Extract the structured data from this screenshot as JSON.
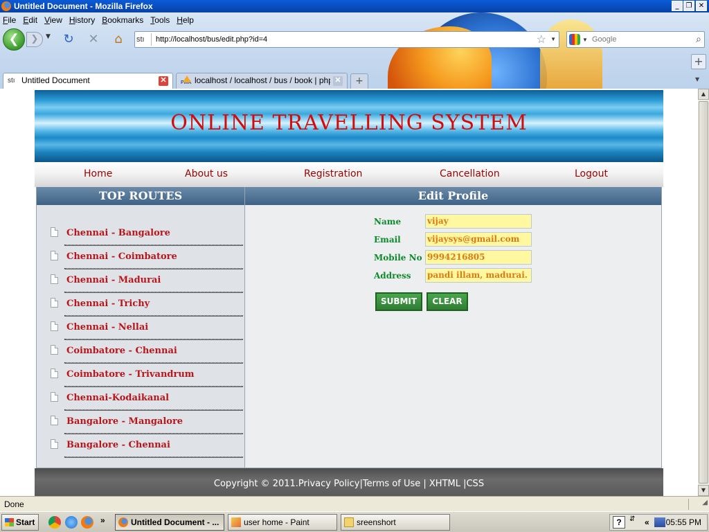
{
  "window": {
    "title": "Untitled Document - Mozilla Firefox",
    "controls": [
      "_",
      "❐",
      "✕"
    ]
  },
  "menu": [
    "File",
    "Edit",
    "View",
    "History",
    "Bookmarks",
    "Tools",
    "Help"
  ],
  "navbar": {
    "site_identity": "stı",
    "url": "http://localhost/bus/edit.php?id=4",
    "search_placeholder": "Google"
  },
  "tabs": [
    {
      "label": "Untitled Document",
      "favicon": "stı",
      "active": true
    },
    {
      "label": "localhost / localhost / bus / book | php...",
      "favicon": "PMA",
      "active": false
    }
  ],
  "site": {
    "title": "ONLINE TRAVELLING SYSTEM",
    "nav": [
      "Home",
      "About us",
      "Registration",
      "Cancellation",
      "Logout"
    ],
    "sidebar_heading": "TOP ROUTES",
    "routes": [
      "Chennai - Bangalore",
      "Chennai - Coimbatore",
      "Chennai - Madurai",
      "Chennai - Trichy",
      "Chennai - Nellai",
      "Coimbatore - Chennai",
      "Coimbatore - Trivandrum",
      "Chennai-Kodaikanal",
      "Bangalore - Mangalore",
      "Bangalore - Chennai"
    ],
    "form_heading": "Edit Profile",
    "fields": [
      {
        "label": "Name",
        "value": "vijay"
      },
      {
        "label": "Email",
        "value": "vijaysys@gmail.com"
      },
      {
        "label": "Mobile No",
        "value": "9994216805"
      },
      {
        "label": "Address",
        "value": "pandi illam, madurai."
      }
    ],
    "submit_label": "SUBMIT",
    "clear_label": "CLEAR",
    "footer": "Copyright © 2011.Privacy Policy|Terms of Use | XHTML |CSS"
  },
  "status": "Done",
  "taskbar": {
    "start": "Start",
    "more": "»",
    "buttons": [
      {
        "label": "Untitled Document - ...",
        "active": true
      },
      {
        "label": "user home - Paint",
        "active": false
      },
      {
        "label": "sreenshort",
        "active": false
      }
    ],
    "tray_arrows": "«",
    "clock": "05:55 PM"
  },
  "colors": {
    "site_title": "#d50b0b",
    "nav_link": "#9b0000",
    "route_link": "#b8161b",
    "form_label": "#0e8a2a",
    "input_bg": "#fff8a0",
    "input_text": "#dd7a12",
    "button_green": "#2e7d32"
  }
}
